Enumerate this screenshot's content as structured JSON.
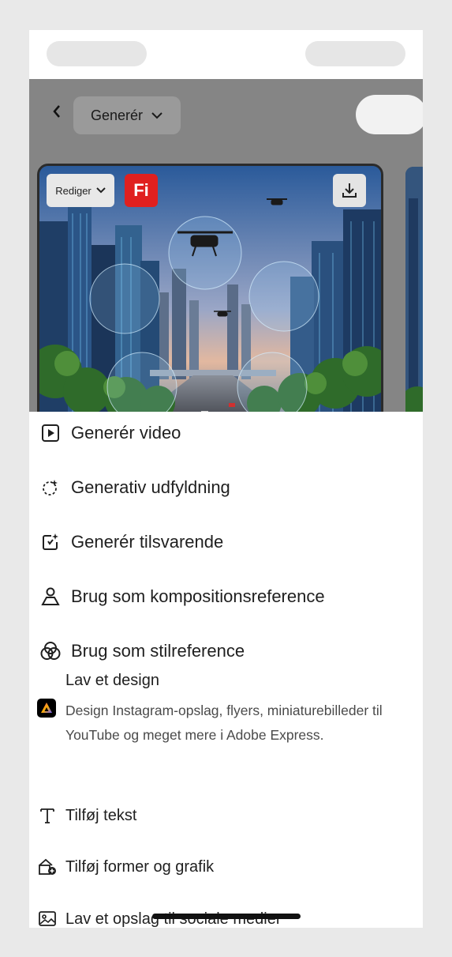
{
  "header": {
    "mode_label": "Generér"
  },
  "card": {
    "edit_label": "Rediger",
    "badge_label": "Fi"
  },
  "menu": {
    "items": [
      {
        "label": "Generér video",
        "icon": "play-video-icon"
      },
      {
        "label": "Generativ udfyldning",
        "icon": "generative-fill-icon"
      },
      {
        "label": "Generér tilsvarende",
        "icon": "generate-similar-icon"
      },
      {
        "label": "Brug som kompositionsreference",
        "icon": "composition-reference-icon"
      },
      {
        "label": "Brug som stilreference",
        "icon": "style-reference-icon"
      }
    ],
    "design": {
      "title": "Lav et design",
      "description": "Design Instagram-opslag, flyers, miniaturebilleder til YouTube og meget mere i Adobe Express.",
      "icon": "adobe-express-icon"
    },
    "extra_items": [
      {
        "label": "Tilføj tekst",
        "icon": "text-icon"
      },
      {
        "label": "Tilføj former og grafik",
        "icon": "shapes-icon"
      },
      {
        "label": "Lav et opslag til sociale medier",
        "icon": "social-post-icon"
      }
    ]
  },
  "colors": {
    "fi_badge": "#e0201f",
    "overlay": "#858585"
  }
}
